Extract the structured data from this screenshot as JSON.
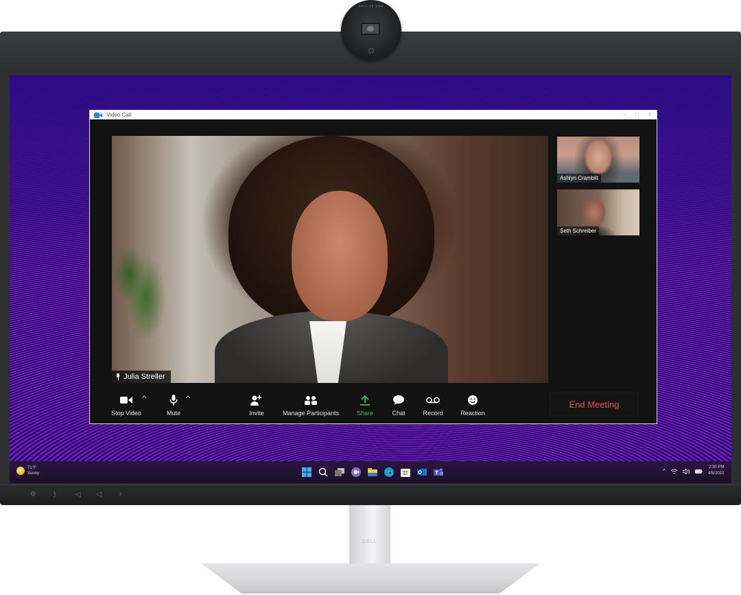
{
  "webcam": {
    "brand_label": "DELL  2K QHD"
  },
  "window": {
    "title": "Video Call",
    "controls": {
      "minimize": "–",
      "maximize": "□",
      "close": "×"
    }
  },
  "main_video": {
    "participant_name": "Julia Streller",
    "icon": "microphone-icon"
  },
  "thumbnails": [
    {
      "participant_name": "Ashlyn Cramblit"
    },
    {
      "participant_name": "Seth Schreiber"
    }
  ],
  "toolbar": {
    "buttons": [
      {
        "label": "Stop Video",
        "icon": "video-camera-icon"
      },
      {
        "label": "Mute",
        "icon": "microphone-icon"
      },
      {
        "label": "Invite",
        "icon": "add-person-icon"
      },
      {
        "label": "Manage Participants",
        "icon": "participants-icon"
      },
      {
        "label": "Share",
        "icon": "share-upload-icon"
      },
      {
        "label": "Chat",
        "icon": "chat-bubble-icon"
      },
      {
        "label": "Record",
        "icon": "record-icon"
      },
      {
        "label": "Reaction",
        "icon": "smiley-icon"
      }
    ],
    "caret": "^",
    "end_meeting_label": "End Meeting",
    "share_color": "#3fbf4a",
    "end_color": "#e0554f"
  },
  "taskbar": {
    "weather": {
      "temperature": "71°F",
      "condition": "Sunny"
    },
    "apps": [
      "windows-start",
      "search",
      "task-view",
      "chat",
      "file-explorer",
      "edge",
      "store",
      "outlook",
      "teams"
    ],
    "tray": {
      "chevron": "^",
      "wifi": "wifi",
      "volume": "volume",
      "battery": "battery"
    },
    "clock": {
      "time": "2:30 PM",
      "date": "4/5/2022"
    }
  },
  "stand": {
    "logo": "DELL"
  }
}
